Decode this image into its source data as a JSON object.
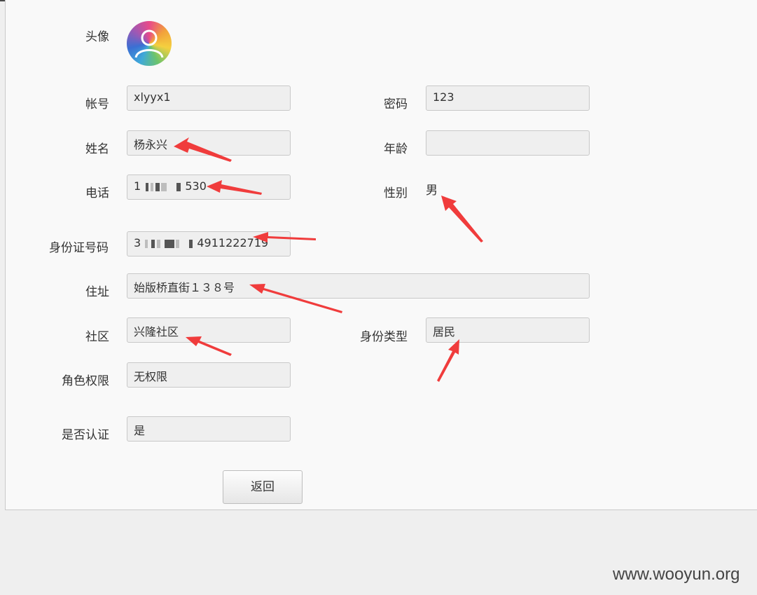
{
  "form": {
    "avatar_label": "头像",
    "account_label": "帐号",
    "account_value": "xlyyx1",
    "password_label": "密码",
    "password_value": "123",
    "name_label": "姓名",
    "name_value": "杨永兴",
    "age_label": "年龄",
    "age_value": "",
    "phone_label": "电话",
    "phone_prefix": "1",
    "phone_suffix": "530",
    "gender_label": "性别",
    "gender_value": "男",
    "id_label": "身份证号码",
    "id_prefix": "3",
    "id_suffix": "4911222719",
    "address_label": "住址",
    "address_value": "始版桥直街１３８号",
    "community_label": "社区",
    "community_value": "兴隆社区",
    "idtype_label": "身份类型",
    "idtype_value": "居民",
    "role_label": "角色权限",
    "role_value": "无权限",
    "verified_label": "是否认证",
    "verified_value": "是",
    "back_button": "返回"
  },
  "watermark": "www.wooyun.org",
  "colors": {
    "arrow": "#f03c3c",
    "field_bg": "#efefef",
    "panel_bg": "#f9f9f9"
  }
}
